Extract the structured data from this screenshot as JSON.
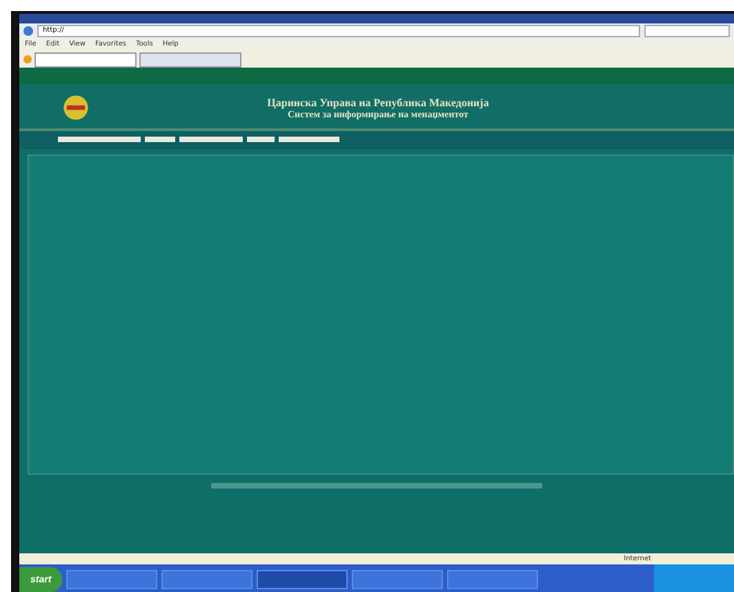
{
  "browser": {
    "address": "http://",
    "menu": [
      "File",
      "Edit",
      "View",
      "Favorites",
      "Tools",
      "Help"
    ],
    "tabs": [
      {
        "selected": true
      },
      {
        "selected": false
      }
    ]
  },
  "page": {
    "title": "Царинска Управа на Република Македонија",
    "subtitle": "Систем за информирање на менаџментот",
    "nav": [
      {
        "selected": false
      },
      {
        "selected": false
      },
      {
        "selected": false
      },
      {
        "selected": false
      },
      {
        "selected": false
      }
    ]
  },
  "status_bar": {
    "zone": "Internet"
  },
  "taskbar": {
    "start": "start",
    "windows": [
      {
        "selected": false
      },
      {
        "selected": false
      },
      {
        "selected": true
      },
      {
        "selected": false
      },
      {
        "selected": false
      }
    ]
  }
}
